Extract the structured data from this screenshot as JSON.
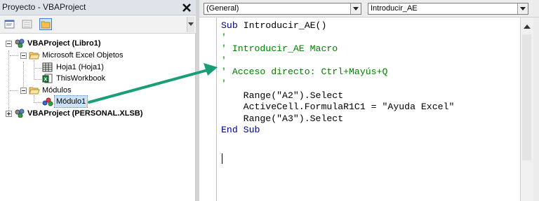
{
  "project_pane": {
    "title": "Proyecto - VBAProject",
    "close_glyph": "✕",
    "toolbar": {
      "view_code_icon": "view-code-icon",
      "view_object_icon": "view-object-icon",
      "toggle_folders_icon": "folder-icon"
    },
    "tree": {
      "project1": "VBAProject (Libro1)",
      "excel_objects_folder": "Microsoft Excel Objetos",
      "sheet1": "Hoja1 (Hoja1)",
      "thisworkbook": "ThisWorkbook",
      "modules_folder": "Módulos",
      "module1": "Módulo1",
      "project2": "VBAProject (PERSONAL.XLSB)"
    }
  },
  "code_pane": {
    "object_combo": "(General)",
    "procedure_combo": "Introducir_AE",
    "code_lines": [
      [
        {
          "t": "Sub ",
          "c": "kw"
        },
        {
          "t": "Introducir_AE()",
          "c": "tx"
        }
      ],
      [
        {
          "t": "'",
          "c": "cm"
        }
      ],
      [
        {
          "t": "' Introducir_AE Macro",
          "c": "cm"
        }
      ],
      [
        {
          "t": "'",
          "c": "cm"
        }
      ],
      [
        {
          "t": "' Acceso directo: Ctrl+Mayús+Q",
          "c": "cm"
        }
      ],
      [
        {
          "t": "'",
          "c": "cm"
        }
      ],
      [
        {
          "t": "    Range(\"A2\").Select",
          "c": "tx"
        }
      ],
      [
        {
          "t": "    ActiveCell.FormulaR1C1 = \"Ayuda Excel\"",
          "c": "tx"
        }
      ],
      [
        {
          "t": "    Range(\"A3\").Select",
          "c": "tx"
        }
      ],
      [
        {
          "t": "End Sub",
          "c": "kw"
        }
      ]
    ]
  },
  "colors": {
    "keyword": "#00007f",
    "comment": "#008000",
    "annotation_arrow": "#1a9e78"
  }
}
